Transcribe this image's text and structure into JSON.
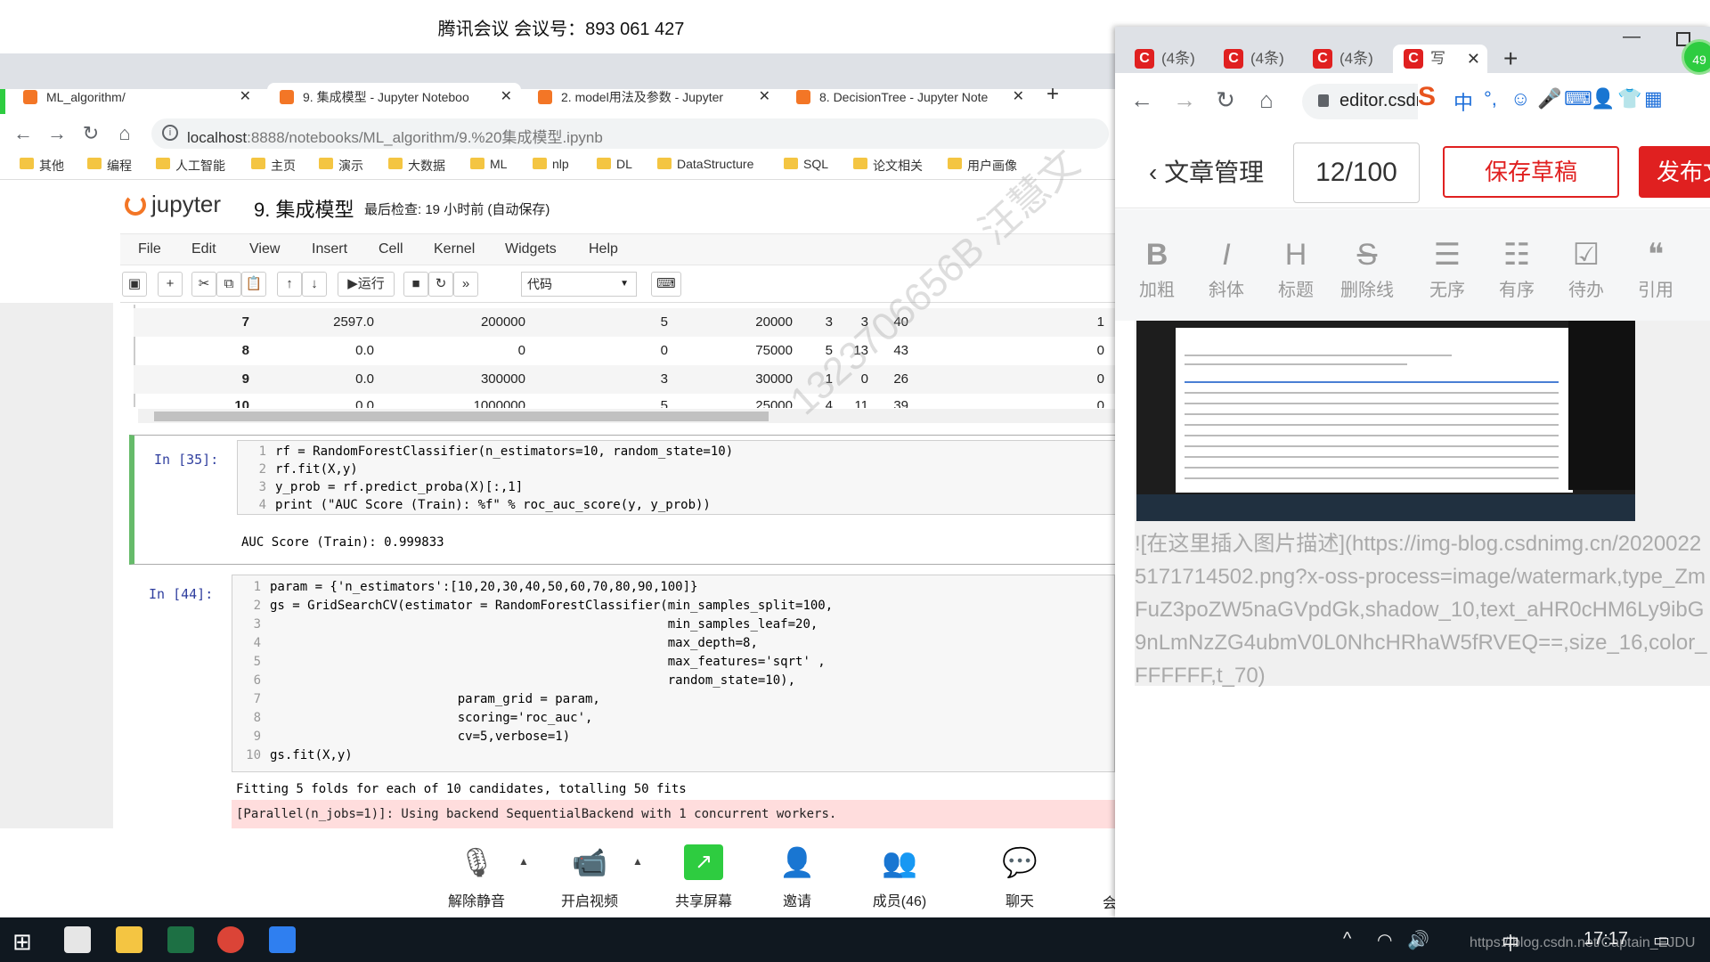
{
  "meeting": {
    "title": "腾讯会议 会议号：893 061 427",
    "toolbar": [
      {
        "label": "解除静音",
        "icon": "mic-muted-icon"
      },
      {
        "label": "开启视频",
        "icon": "video-off-icon"
      },
      {
        "label": "共享屏幕",
        "icon": "share-screen-icon"
      },
      {
        "label": "邀请",
        "icon": "invite-icon"
      },
      {
        "label": "成员(46)",
        "icon": "members-icon"
      },
      {
        "label": "聊天",
        "icon": "chat-icon"
      },
      {
        "label": "会"
      }
    ]
  },
  "left_browser": {
    "tabs": [
      {
        "label": "ML_algorithm/"
      },
      {
        "label": "9. 集成模型 - Jupyter Noteboo"
      },
      {
        "label": "2. model用法及参数 - Jupyter"
      },
      {
        "label": "8. DecisionTree - Jupyter Note"
      }
    ],
    "new_tab": "+",
    "url_host": "localhost",
    "url_path": ":8888/notebooks/ML_algorithm/9.%20集成模型.ipynb",
    "bookmarks": [
      "其他",
      "编程",
      "人工智能",
      "主页",
      "演示",
      "大数据",
      "ML",
      "nlp",
      "DL",
      "DataStructure",
      "SQL",
      "论文相关",
      "用户画像"
    ]
  },
  "jupyter": {
    "logo": "jupyter",
    "notebook_name": "9. 集成模型",
    "checkpoint": "最后检查: 19 小时前  (自动保存)",
    "menu": [
      "File",
      "Edit",
      "View",
      "Insert",
      "Cell",
      "Kernel",
      "Widgets",
      "Help"
    ],
    "toolbar": {
      "run_label": "运行",
      "cell_type": "代码"
    },
    "output_rows": [
      [
        "7",
        "2597.0",
        "200000",
        "5",
        "20000",
        "3",
        "3",
        "40",
        "1"
      ],
      [
        "8",
        "0.0",
        "0",
        "0",
        "75000",
        "5",
        "13",
        "43",
        "0"
      ],
      [
        "9",
        "0.0",
        "300000",
        "3",
        "30000",
        "1",
        "0",
        "26",
        "0"
      ],
      [
        "10",
        "0.0",
        "1000000",
        "5",
        "25000",
        "4",
        "11",
        "39",
        "0"
      ]
    ],
    "cell35": {
      "prompt": "In  [35]:",
      "lines": [
        "rf = RandomForestClassifier(n_estimators=10, random_state=10)",
        "rf.fit(X,y)",
        "y_prob = rf.predict_proba(X)[:,1]",
        "print (\"AUC Score (Train): %f\" % roc_auc_score(y, y_prob))"
      ],
      "output": "AUC Score (Train): 0.999833"
    },
    "cell44": {
      "prompt": "In  [44]:",
      "lines": [
        "param = {'n_estimators':[10,20,30,40,50,60,70,80,90,100]}",
        "gs = GridSearchCV(estimator = RandomForestClassifier(min_samples_split=100,",
        "                                                     min_samples_leaf=20,",
        "                                                     max_depth=8,",
        "                                                     max_features='sqrt' ,",
        "                                                     random_state=10),",
        "                         param_grid = param,",
        "                         scoring='roc_auc',",
        "                         cv=5,verbose=1)",
        "gs.fit(X,y)"
      ],
      "output": "Fitting 5 folds for each of 10 candidates, totalling 50 fits",
      "stderr": "[Parallel(n_jobs=1)]: Using backend SequentialBackend with 1 concurrent workers."
    },
    "watermark": "1323706656B 汪慧文"
  },
  "right_browser": {
    "tabs": [
      {
        "label": "(4条)"
      },
      {
        "label": "(4条)"
      },
      {
        "label": "(4条)"
      },
      {
        "label": "写"
      }
    ],
    "new_tab": "+",
    "url": "editor.csdn",
    "editor": {
      "back_label": "文章管理",
      "title_count": "12/100",
      "save_draft": "保存草稿",
      "publish": "发布文",
      "badge": "49"
    },
    "format_tools": [
      {
        "icon": "B",
        "label": "加粗"
      },
      {
        "icon": "I",
        "label": "斜体"
      },
      {
        "icon": "H",
        "label": "标题"
      },
      {
        "icon": "S",
        "label": "删除线"
      },
      {
        "icon": "☰",
        "label": "无序"
      },
      {
        "icon": "☷",
        "label": "有序"
      },
      {
        "icon": "☑",
        "label": "待办"
      },
      {
        "icon": "❝",
        "label": "引用"
      }
    ],
    "markdown_text": "![在这里插入图片描述](https://img-blog.csdnimg.cn/20200225171714502.png?x-oss-process=image/watermark,type_ZmFuZ3poZW5naGVpdGk,shadow_10,text_aHR0cHM6Ly9ibG9nLmNzZG4ubmV0L0NhcHRhaW5fRVEQ==,size_16,color_FFFFFF,t_70)"
  },
  "taskbar": {
    "ime": "中",
    "time": "17:17",
    "url_watermark": "https://blog.csdn.net/Captain_EJDU"
  },
  "colors": {
    "accent_green": "#2ecc40",
    "csdn_red": "#e02020",
    "jupyter_orange": "#f37626"
  }
}
